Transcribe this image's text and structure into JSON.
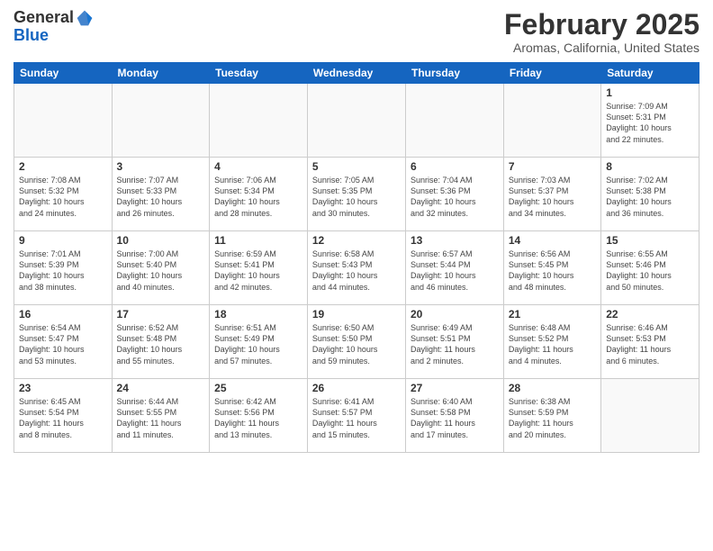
{
  "logo": {
    "general": "General",
    "blue": "Blue"
  },
  "header": {
    "title": "February 2025",
    "subtitle": "Aromas, California, United States"
  },
  "weekdays": [
    "Sunday",
    "Monday",
    "Tuesday",
    "Wednesday",
    "Thursday",
    "Friday",
    "Saturday"
  ],
  "weeks": [
    [
      {
        "day": "",
        "info": ""
      },
      {
        "day": "",
        "info": ""
      },
      {
        "day": "",
        "info": ""
      },
      {
        "day": "",
        "info": ""
      },
      {
        "day": "",
        "info": ""
      },
      {
        "day": "",
        "info": ""
      },
      {
        "day": "1",
        "info": "Sunrise: 7:09 AM\nSunset: 5:31 PM\nDaylight: 10 hours\nand 22 minutes."
      }
    ],
    [
      {
        "day": "2",
        "info": "Sunrise: 7:08 AM\nSunset: 5:32 PM\nDaylight: 10 hours\nand 24 minutes."
      },
      {
        "day": "3",
        "info": "Sunrise: 7:07 AM\nSunset: 5:33 PM\nDaylight: 10 hours\nand 26 minutes."
      },
      {
        "day": "4",
        "info": "Sunrise: 7:06 AM\nSunset: 5:34 PM\nDaylight: 10 hours\nand 28 minutes."
      },
      {
        "day": "5",
        "info": "Sunrise: 7:05 AM\nSunset: 5:35 PM\nDaylight: 10 hours\nand 30 minutes."
      },
      {
        "day": "6",
        "info": "Sunrise: 7:04 AM\nSunset: 5:36 PM\nDaylight: 10 hours\nand 32 minutes."
      },
      {
        "day": "7",
        "info": "Sunrise: 7:03 AM\nSunset: 5:37 PM\nDaylight: 10 hours\nand 34 minutes."
      },
      {
        "day": "8",
        "info": "Sunrise: 7:02 AM\nSunset: 5:38 PM\nDaylight: 10 hours\nand 36 minutes."
      }
    ],
    [
      {
        "day": "9",
        "info": "Sunrise: 7:01 AM\nSunset: 5:39 PM\nDaylight: 10 hours\nand 38 minutes."
      },
      {
        "day": "10",
        "info": "Sunrise: 7:00 AM\nSunset: 5:40 PM\nDaylight: 10 hours\nand 40 minutes."
      },
      {
        "day": "11",
        "info": "Sunrise: 6:59 AM\nSunset: 5:41 PM\nDaylight: 10 hours\nand 42 minutes."
      },
      {
        "day": "12",
        "info": "Sunrise: 6:58 AM\nSunset: 5:43 PM\nDaylight: 10 hours\nand 44 minutes."
      },
      {
        "day": "13",
        "info": "Sunrise: 6:57 AM\nSunset: 5:44 PM\nDaylight: 10 hours\nand 46 minutes."
      },
      {
        "day": "14",
        "info": "Sunrise: 6:56 AM\nSunset: 5:45 PM\nDaylight: 10 hours\nand 48 minutes."
      },
      {
        "day": "15",
        "info": "Sunrise: 6:55 AM\nSunset: 5:46 PM\nDaylight: 10 hours\nand 50 minutes."
      }
    ],
    [
      {
        "day": "16",
        "info": "Sunrise: 6:54 AM\nSunset: 5:47 PM\nDaylight: 10 hours\nand 53 minutes."
      },
      {
        "day": "17",
        "info": "Sunrise: 6:52 AM\nSunset: 5:48 PM\nDaylight: 10 hours\nand 55 minutes."
      },
      {
        "day": "18",
        "info": "Sunrise: 6:51 AM\nSunset: 5:49 PM\nDaylight: 10 hours\nand 57 minutes."
      },
      {
        "day": "19",
        "info": "Sunrise: 6:50 AM\nSunset: 5:50 PM\nDaylight: 10 hours\nand 59 minutes."
      },
      {
        "day": "20",
        "info": "Sunrise: 6:49 AM\nSunset: 5:51 PM\nDaylight: 11 hours\nand 2 minutes."
      },
      {
        "day": "21",
        "info": "Sunrise: 6:48 AM\nSunset: 5:52 PM\nDaylight: 11 hours\nand 4 minutes."
      },
      {
        "day": "22",
        "info": "Sunrise: 6:46 AM\nSunset: 5:53 PM\nDaylight: 11 hours\nand 6 minutes."
      }
    ],
    [
      {
        "day": "23",
        "info": "Sunrise: 6:45 AM\nSunset: 5:54 PM\nDaylight: 11 hours\nand 8 minutes."
      },
      {
        "day": "24",
        "info": "Sunrise: 6:44 AM\nSunset: 5:55 PM\nDaylight: 11 hours\nand 11 minutes."
      },
      {
        "day": "25",
        "info": "Sunrise: 6:42 AM\nSunset: 5:56 PM\nDaylight: 11 hours\nand 13 minutes."
      },
      {
        "day": "26",
        "info": "Sunrise: 6:41 AM\nSunset: 5:57 PM\nDaylight: 11 hours\nand 15 minutes."
      },
      {
        "day": "27",
        "info": "Sunrise: 6:40 AM\nSunset: 5:58 PM\nDaylight: 11 hours\nand 17 minutes."
      },
      {
        "day": "28",
        "info": "Sunrise: 6:38 AM\nSunset: 5:59 PM\nDaylight: 11 hours\nand 20 minutes."
      },
      {
        "day": "",
        "info": ""
      }
    ]
  ]
}
